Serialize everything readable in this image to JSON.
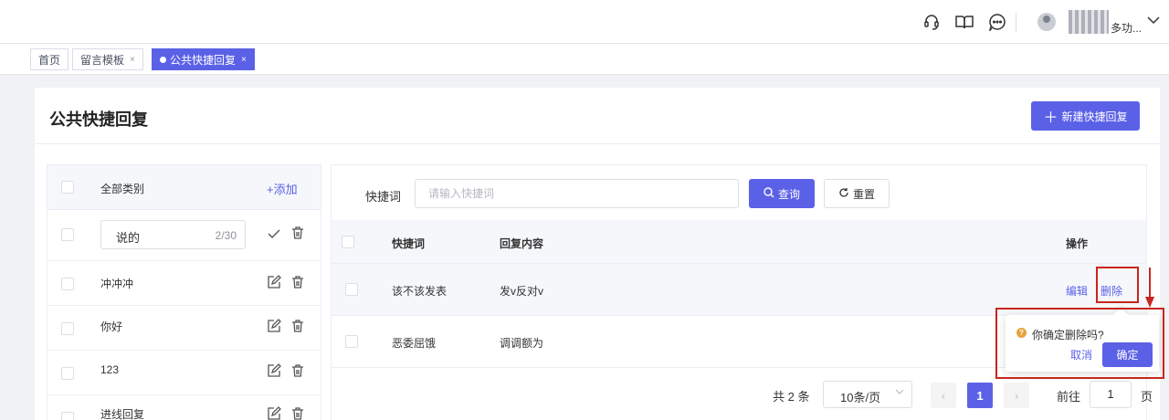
{
  "header": {
    "icons": [
      "headset-icon",
      "book-icon",
      "chat-icon"
    ],
    "user_name_suffix": "多功..."
  },
  "tabs": [
    {
      "label": "首页",
      "closable": false,
      "active": false
    },
    {
      "label": "留言模板",
      "closable": true,
      "active": false
    },
    {
      "label": "公共快捷回复",
      "closable": true,
      "active": true
    }
  ],
  "tab_close_glyph": "×",
  "page": {
    "title": "公共快捷回复",
    "new_button": "新建快捷回复"
  },
  "categories": {
    "header_label": "全部类别",
    "add_label": "+添加",
    "editing": {
      "value": "说的",
      "count": "2/30"
    },
    "items": [
      "冲冲冲",
      "你好",
      "123",
      "进线回复"
    ]
  },
  "search": {
    "label": "快捷词",
    "placeholder": "请输入快捷词",
    "query_button": "查询",
    "reset_button": "重置"
  },
  "table": {
    "columns": [
      "快捷词",
      "回复内容",
      "操作"
    ],
    "rows": [
      {
        "keyword": "该不该发表",
        "content": "发v反对v",
        "edit": "编辑",
        "delete": "删除"
      },
      {
        "keyword": "恶委屈饿",
        "content": "调调额为"
      }
    ]
  },
  "pagination": {
    "total": "共 2 条",
    "page_size": "10条/页",
    "current_page": "1",
    "goto_label": "前往",
    "goto_value": "1",
    "page_suffix": "页"
  },
  "popconfirm": {
    "message": "你确定删除吗?",
    "cancel": "取消",
    "confirm": "确定"
  },
  "colors": {
    "primary": "#5b61e6",
    "highlight_border": "#c8261c",
    "warning": "#e6a23c"
  }
}
